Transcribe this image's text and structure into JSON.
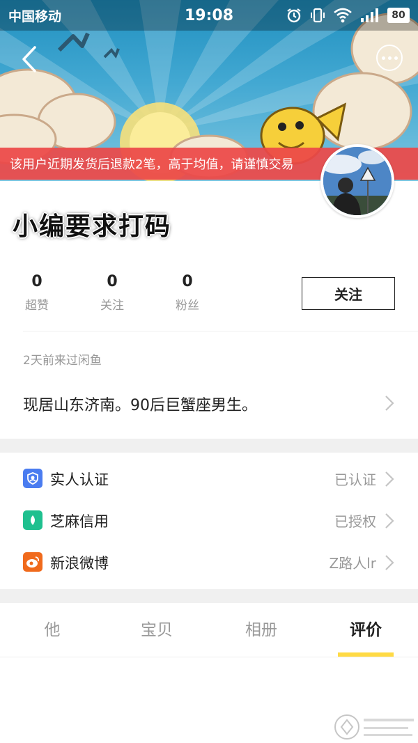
{
  "status_bar": {
    "carrier": "中国移动",
    "time": "19:08",
    "battery": "80"
  },
  "banner": {
    "warning": "该用户近期发货后退款2笔，高于均值，请谨慎交易"
  },
  "profile": {
    "username": "小编要求打码",
    "stats": [
      {
        "value": "0",
        "label": "超赞"
      },
      {
        "value": "0",
        "label": "关注"
      },
      {
        "value": "0",
        "label": "粉丝"
      }
    ],
    "follow_label": "关注",
    "last_seen": "2天前来过闲鱼",
    "bio": "现居山东济南。90后巨蟹座男生。"
  },
  "verifications": [
    {
      "label": "实人认证",
      "status": "已认证",
      "icon": "real-person-icon",
      "color": "#4a7cf0"
    },
    {
      "label": "芝麻信用",
      "status": "已授权",
      "icon": "sesame-credit-icon",
      "color": "#1fc08f"
    },
    {
      "label": "新浪微博",
      "status": "Z路人lr",
      "icon": "weibo-icon",
      "color": "#f06a1c"
    }
  ],
  "tabs": {
    "items": [
      "他",
      "宝贝",
      "相册",
      "评价"
    ],
    "active": "评价"
  },
  "colors": {
    "warning_bg": "#ec4848",
    "tab_accent": "#ffda44"
  }
}
